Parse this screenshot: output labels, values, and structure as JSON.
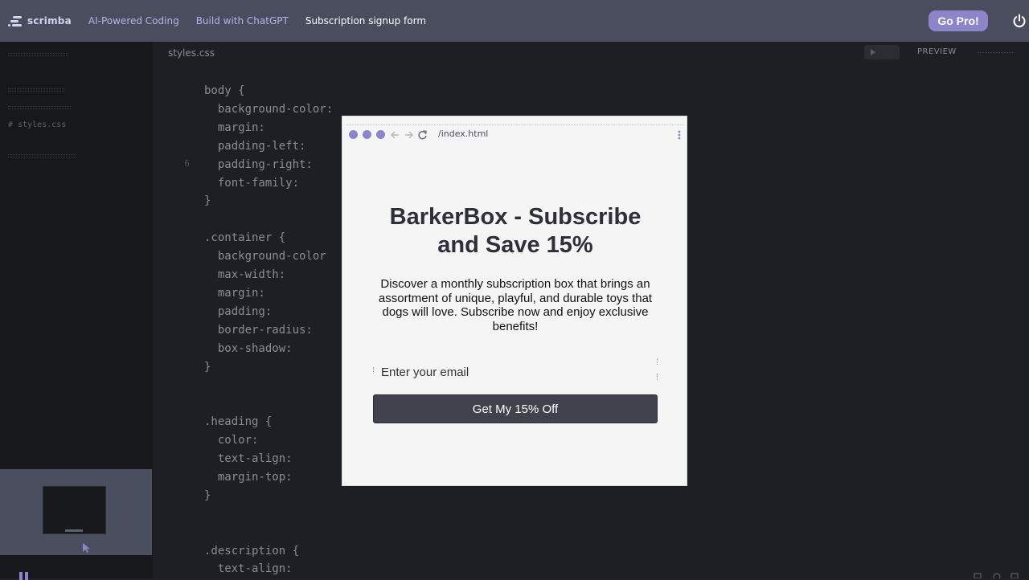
{
  "nav": {
    "brand": "scrimba",
    "breadcrumbs": [
      "AI-Powered Coding",
      "Build with ChatGPT",
      "Subscription signup form"
    ],
    "go_pro_label": "Go Pro!",
    "power_icon": "power-icon"
  },
  "sidebar": {
    "files": [
      {
        "label": "",
        "blurred": true
      },
      {
        "label": "",
        "blurred": true
      },
      {
        "label": "# styles.css",
        "blurred": false
      },
      {
        "label": "",
        "blurred": true
      }
    ]
  },
  "editor": {
    "tab_label": "styles.css",
    "preview_label": "PREVIEW",
    "code_lines": [
      {
        "ln": "",
        "text": "body {"
      },
      {
        "ln": "",
        "text": "  background-color: "
      },
      {
        "ln": "",
        "text": "  margin: "
      },
      {
        "ln": "",
        "text": "  padding-left: "
      },
      {
        "ln": "6",
        "text": "  padding-right: "
      },
      {
        "ln": "",
        "text": "  font-family: "
      },
      {
        "ln": "",
        "text": "}"
      },
      {
        "ln": "",
        "text": ""
      },
      {
        "ln": "",
        "text": ".container {"
      },
      {
        "ln": "",
        "text": "  background-color"
      },
      {
        "ln": "",
        "text": "  max-width: "
      },
      {
        "ln": "",
        "text": "  margin: "
      },
      {
        "ln": "",
        "text": "  padding: "
      },
      {
        "ln": "",
        "text": "  border-radius: "
      },
      {
        "ln": "",
        "text": "  box-shadow: "
      },
      {
        "ln": "",
        "text": "}"
      },
      {
        "ln": "",
        "text": ""
      },
      {
        "ln": "",
        "text": ""
      },
      {
        "ln": "",
        "text": ".heading {"
      },
      {
        "ln": "",
        "text": "  color: "
      },
      {
        "ln": "",
        "text": "  text-align: "
      },
      {
        "ln": "",
        "text": "  margin-top: "
      },
      {
        "ln": "",
        "text": "}"
      },
      {
        "ln": "",
        "text": ""
      },
      {
        "ln": "",
        "text": ""
      },
      {
        "ln": "",
        "text": ".description {"
      },
      {
        "ln": "",
        "text": "  text-align: "
      }
    ]
  },
  "preview": {
    "url": "/index.html",
    "title": "BarkerBox - Subscribe and Save 15%",
    "description": "Discover a monthly subscription box that brings an assortment of unique, playful, and durable toys that dogs will love. Subscribe now and enjoy exclusive benefits!",
    "email_placeholder": "Enter your email",
    "submit_label": "Get My 15% Off"
  },
  "colors": {
    "topbar": "#4a4d5e",
    "accent": "#8c85c9",
    "editor_bg": "#1e1f24",
    "button_bg": "#40424d"
  }
}
